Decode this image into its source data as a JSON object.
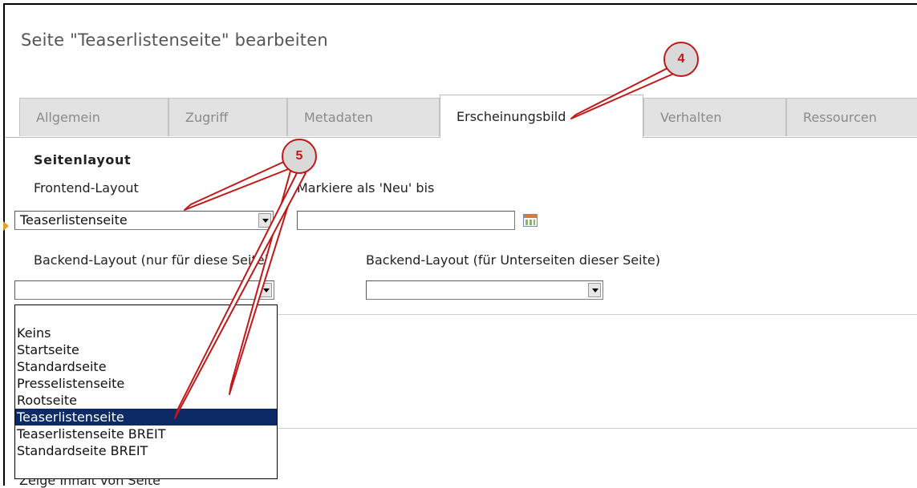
{
  "page_title": "Seite \"Teaserlistenseite\" bearbeiten",
  "tabs": [
    {
      "label": "Allgemein",
      "active": false
    },
    {
      "label": "Zugriff",
      "active": false
    },
    {
      "label": "Metadaten",
      "active": false
    },
    {
      "label": "Erscheinungsbild",
      "active": true
    },
    {
      "label": "Verhalten",
      "active": false
    },
    {
      "label": "Ressourcen",
      "active": false
    }
  ],
  "section": {
    "title": "Seitenlayout",
    "frontend_layout": {
      "label": "Frontend-Layout",
      "value": "Teaserlistenseite"
    },
    "new_until": {
      "label": "Markiere als 'Neu' bis",
      "value": ""
    },
    "backend_layout_this": {
      "label": "Backend-Layout (nur für diese Seite)",
      "value": ""
    },
    "backend_layout_sub": {
      "label": "Backend-Layout (für Unterseiten dieser Seite)",
      "value": ""
    }
  },
  "dropdown": {
    "options": [
      "",
      "Keins",
      "Startseite",
      "Standardseite",
      "Presselistenseite",
      "Rootseite",
      "Teaserlistenseite",
      "Teaserlistenseite BREIT",
      "Standardseite BREIT"
    ],
    "selected": "Teaserlistenseite"
  },
  "cut_off_label": "Zeige Inhalt von Seite",
  "callouts": [
    "4",
    "5"
  ],
  "colors": {
    "callout_border": "#c01818",
    "callout_fill": "#d9d9d9",
    "selected_option_bg": "#0b2a66",
    "tab_inactive_bg": "#e2e2e2",
    "marker": "#e1a12b"
  },
  "icons": {
    "date_picker": "calendar-icon",
    "select_arrow": "chevron-down-icon",
    "required_marker": "arrow-marker-icon"
  }
}
